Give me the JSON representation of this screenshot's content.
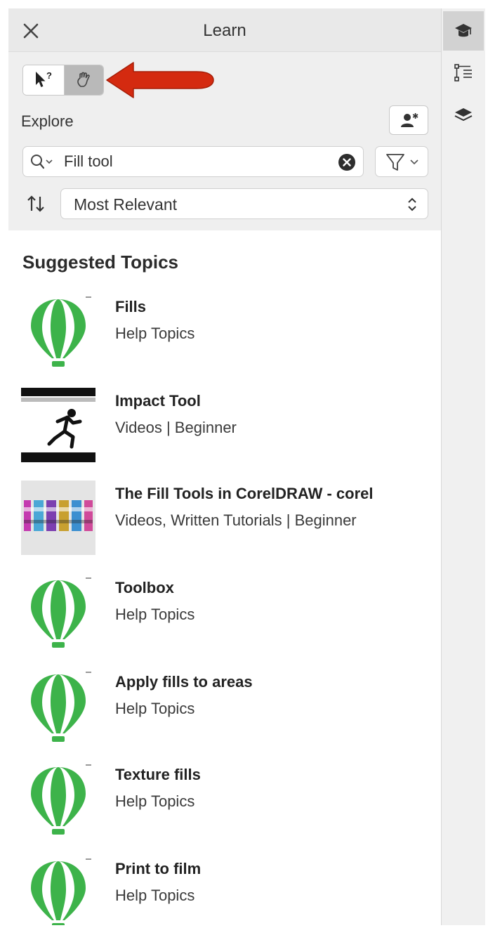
{
  "panel": {
    "title": "Learn",
    "close_icon": "close-icon"
  },
  "mode_toggle": {
    "help_icon": "cursor-help-icon",
    "learn_icon": "hand-icon"
  },
  "explore": {
    "label": "Explore",
    "profile_icon": "user-star-icon"
  },
  "search": {
    "value": "Fill tool",
    "icon": "search-icon",
    "clear_icon": "clear-circle-icon"
  },
  "filter": {
    "icon": "filter-funnel-icon"
  },
  "sort": {
    "icon": "sort-arrows-icon",
    "selected": "Most Relevant"
  },
  "suggested": {
    "heading": "Suggested Topics",
    "topics": [
      {
        "title": "Fills",
        "subtitle": "Help Topics",
        "thumb": "balloon-logo"
      },
      {
        "title": "Impact Tool",
        "subtitle": "Videos | Beginner",
        "thumb": "runner-video"
      },
      {
        "title": "The Fill Tools in CorelDRAW - corel",
        "subtitle": "Videos, Written Tutorials | Beginner",
        "thumb": "fills-text-video"
      },
      {
        "title": "Toolbox",
        "subtitle": "Help Topics",
        "thumb": "balloon-logo"
      },
      {
        "title": "Apply fills to areas",
        "subtitle": "Help Topics",
        "thumb": "balloon-logo"
      },
      {
        "title": "Texture fills",
        "subtitle": "Help Topics",
        "thumb": "balloon-logo"
      },
      {
        "title": "Print to film",
        "subtitle": "Help Topics",
        "thumb": "balloon-logo"
      }
    ]
  },
  "right_strip": {
    "icons": [
      "graduation-cap-icon",
      "properties-icon",
      "layers-icon"
    ]
  },
  "colors": {
    "arrow": "#d42a10",
    "balloon_green": "#3db34a",
    "balloon_light": "#ffffff",
    "toggle_active": "#b9b9b9"
  }
}
